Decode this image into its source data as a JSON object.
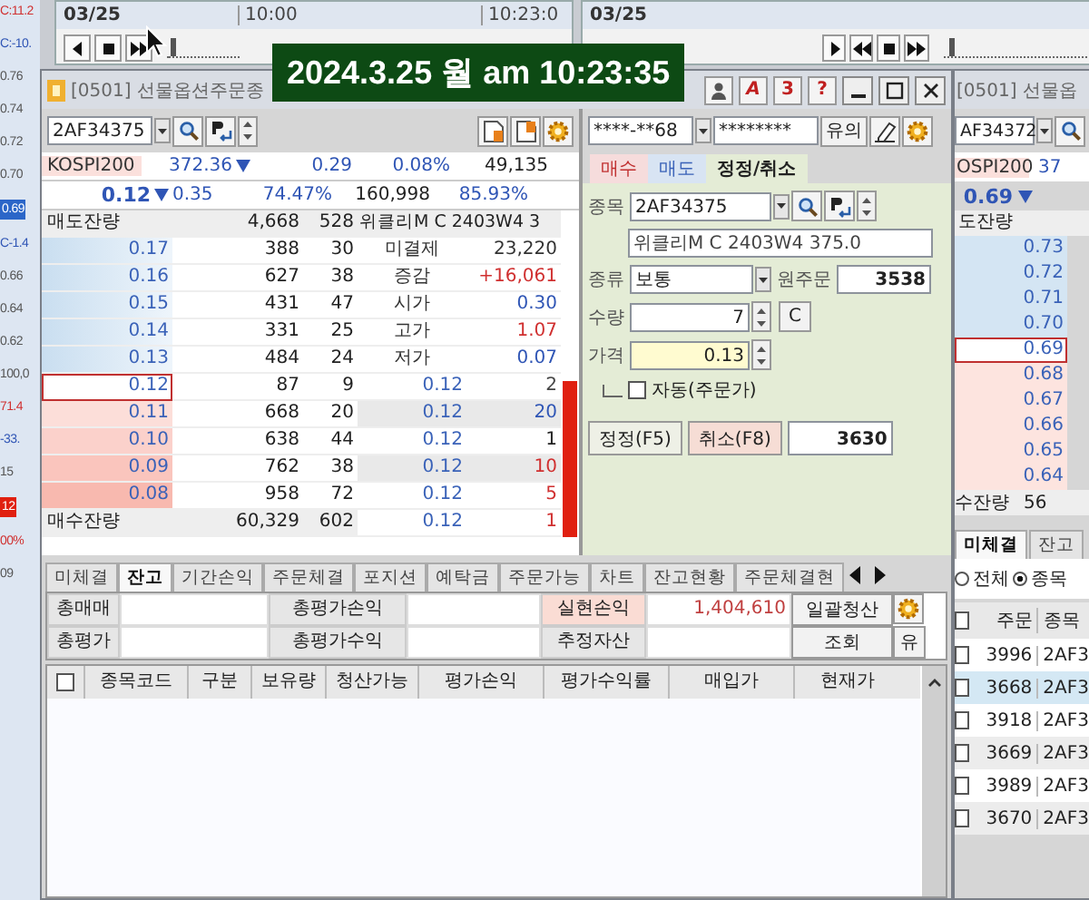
{
  "left_strip": {
    "items": [
      {
        "text": "C:11.2",
        "kind": "up"
      },
      {
        "text": "C:-10.",
        "kind": "down"
      },
      {
        "text": "0.76",
        "kind": "plain"
      },
      {
        "text": "0.74",
        "kind": "plain"
      },
      {
        "text": "0.72",
        "kind": "plain"
      },
      {
        "text": "0.70",
        "kind": "plain"
      },
      {
        "text": "0.69",
        "kind": "selected"
      },
      {
        "text": "C-1.4",
        "kind": "down"
      },
      {
        "text": "0.66",
        "kind": "plain"
      },
      {
        "text": "0.64",
        "kind": "plain"
      },
      {
        "text": "0.62",
        "kind": "plain"
      },
      {
        "text": "100,0",
        "kind": "plain"
      },
      {
        "text": "71.4",
        "kind": "up"
      },
      {
        "text": "-33.",
        "kind": "down"
      },
      {
        "text": "15",
        "kind": "plain"
      },
      {
        "text": "12",
        "kind": "alert"
      },
      {
        "text": "00%",
        "kind": "up"
      },
      {
        "text": "09",
        "kind": "plain"
      }
    ]
  },
  "players": [
    {
      "date": "03/25",
      "start": "10:00",
      "end": "10:23:0",
      "level": 0.05
    },
    {
      "date": "03/25",
      "level": 0.04
    }
  ],
  "banner": "2024.3.25 월 am 10:23:35",
  "main_window": {
    "title": "[0501] 선물옵션주문종",
    "tool_buttons": [
      "A",
      "3",
      "?"
    ],
    "quote": {
      "code": "2AF34375",
      "index_name": "KOSPI200",
      "index_value": "372.36",
      "index_change": "0.29",
      "index_rate": "0.08%",
      "index_volume": "49,135",
      "price": "0.12",
      "change": "0.35",
      "rate": "74.47%",
      "volume": "160,998",
      "ratio": "85.93%"
    },
    "orderbook": {
      "ask_total": {
        "label": "매도잔량",
        "qty": "4,668",
        "count": "528"
      },
      "product": "위클리M C 2403W4 3",
      "asks": [
        {
          "price": "0.17",
          "qty": "388",
          "count": "30",
          "selected": false
        },
        {
          "price": "0.16",
          "qty": "627",
          "count": "38",
          "selected": false
        },
        {
          "price": "0.15",
          "qty": "431",
          "count": "47",
          "selected": false
        },
        {
          "price": "0.14",
          "qty": "331",
          "count": "25",
          "selected": false
        },
        {
          "price": "0.13",
          "qty": "484",
          "count": "24",
          "selected": false
        }
      ],
      "info": [
        {
          "label": "미결제",
          "value": "23,220",
          "color": "#333333"
        },
        {
          "label": "증감",
          "value": "+16,061",
          "color": "#d03030"
        },
        {
          "label": "시가",
          "value": "0.30",
          "color": "#2f55b5"
        },
        {
          "label": "고가",
          "value": "1.07",
          "color": "#d03030"
        },
        {
          "label": "저가",
          "value": "0.07",
          "color": "#2f55b5"
        }
      ],
      "bids": [
        {
          "price": "0.12",
          "qty": "87",
          "count": "9",
          "selected": true
        },
        {
          "price": "0.11",
          "qty": "668",
          "count": "20",
          "selected": false
        },
        {
          "price": "0.10",
          "qty": "638",
          "count": "44",
          "selected": false
        },
        {
          "price": "0.09",
          "qty": "762",
          "count": "38",
          "selected": false
        },
        {
          "price": "0.08",
          "qty": "958",
          "count": "72",
          "selected": false
        }
      ],
      "trades": [
        {
          "price": "0.12",
          "qty": "2",
          "color": "#444444"
        },
        {
          "price": "0.12",
          "qty": "20",
          "color": "#2f55b5"
        },
        {
          "price": "0.12",
          "qty": "1",
          "color": "#222222"
        },
        {
          "price": "0.12",
          "qty": "10",
          "color": "#d03030"
        },
        {
          "price": "0.12",
          "qty": "5",
          "color": "#d03030"
        },
        {
          "price": "0.12",
          "qty": "1",
          "color": "#d03030"
        }
      ],
      "bid_total": {
        "label": "매수잔량",
        "qty": "60,329",
        "count": "602"
      }
    },
    "order_form": {
      "account": "****-**68",
      "password": "********",
      "notice_button": "유의",
      "tabs": [
        {
          "label": "매수",
          "kind": "buy",
          "selected": false
        },
        {
          "label": "매도",
          "kind": "sell",
          "selected": false
        },
        {
          "label": "정정/취소",
          "kind": "modify",
          "selected": true
        }
      ],
      "code_label": "종목",
      "code": "2AF34375",
      "name": "위클리M C 2403W4 375.0",
      "type_label": "종류",
      "type": "보통",
      "orig_label": "원주문",
      "orig": "3538",
      "qty_label": "수량",
      "qty": "7",
      "clear_button": "C",
      "price_label": "가격",
      "price": "0.13",
      "auto": {
        "label": "자동(주문가)",
        "checked": false
      },
      "buttons": [
        {
          "label": "정정(F5)",
          "kind": "modify"
        },
        {
          "label": "취소(F8)",
          "kind": "cancel"
        }
      ],
      "order_no": "3630"
    },
    "balance": {
      "tabs": [
        {
          "label": "미체결",
          "selected": false
        },
        {
          "label": "잔고",
          "selected": true
        },
        {
          "label": "기간손익",
          "selected": false
        },
        {
          "label": "주문체결",
          "selected": false
        },
        {
          "label": "포지션",
          "selected": false
        },
        {
          "label": "예탁금",
          "selected": false
        },
        {
          "label": "주문가능",
          "selected": false
        },
        {
          "label": "차트",
          "selected": false
        },
        {
          "label": "잔고현황",
          "selected": false
        },
        {
          "label": "주문체결현",
          "selected": false
        }
      ],
      "summary": [
        [
          {
            "label": "총매매"
          },
          {
            "label": "총평가손익"
          },
          {
            "label": "실현손익",
            "value": "1,404,610",
            "highlight": true
          }
        ],
        [
          {
            "label": "총평가"
          },
          {
            "label": "총평가수익"
          },
          {
            "label": "추정자산",
            "highlight": false
          }
        ]
      ],
      "actions": [
        "일괄청산",
        "조회"
      ],
      "extra_button": "유",
      "header_checked": false,
      "columns": [
        "종목코드",
        "구분",
        "보유량",
        "청산가능",
        "평가손익",
        "평가수익률",
        "매입가",
        "현재가"
      ]
    }
  },
  "side_window": {
    "title": "[0501] 선물옵",
    "code": "AF34372",
    "index_name": "OSPI200",
    "index_value": "37",
    "price": "0.69",
    "ask_label": "도잔량",
    "prices": [
      {
        "price": "0.73",
        "selected": false
      },
      {
        "price": "0.72",
        "selected": false
      },
      {
        "price": "0.71",
        "selected": false
      },
      {
        "price": "0.70",
        "selected": false
      },
      {
        "price": "0.69",
        "selected": true
      },
      {
        "price": "0.68",
        "selected": false
      },
      {
        "price": "0.67",
        "selected": false
      },
      {
        "price": "0.66",
        "selected": false
      },
      {
        "price": "0.65",
        "selected": false
      },
      {
        "price": "0.64",
        "selected": false
      }
    ],
    "bid_label": "수잔량",
    "bid_qty": "56",
    "tabs": [
      {
        "label": "미체결",
        "selected": true
      },
      {
        "label": "잔고",
        "selected": false
      }
    ],
    "radios": [
      {
        "label": "전체",
        "selected": false
      },
      {
        "label": "종목",
        "selected": true
      }
    ],
    "header_checked": false,
    "columns": [
      "주문",
      "종목"
    ],
    "rows": [
      {
        "order": "3996",
        "code": "2AF3",
        "selected": false,
        "checked": false
      },
      {
        "order": "3668",
        "code": "2AF3",
        "selected": true,
        "checked": false
      },
      {
        "order": "3918",
        "code": "2AF3",
        "selected": false,
        "checked": false
      },
      {
        "order": "3669",
        "code": "2AF3",
        "selected": false,
        "checked": false
      },
      {
        "order": "3989",
        "code": "2AF3",
        "selected": false,
        "checked": false
      },
      {
        "order": "3670",
        "code": "2AF3",
        "selected": false,
        "checked": false
      }
    ]
  }
}
